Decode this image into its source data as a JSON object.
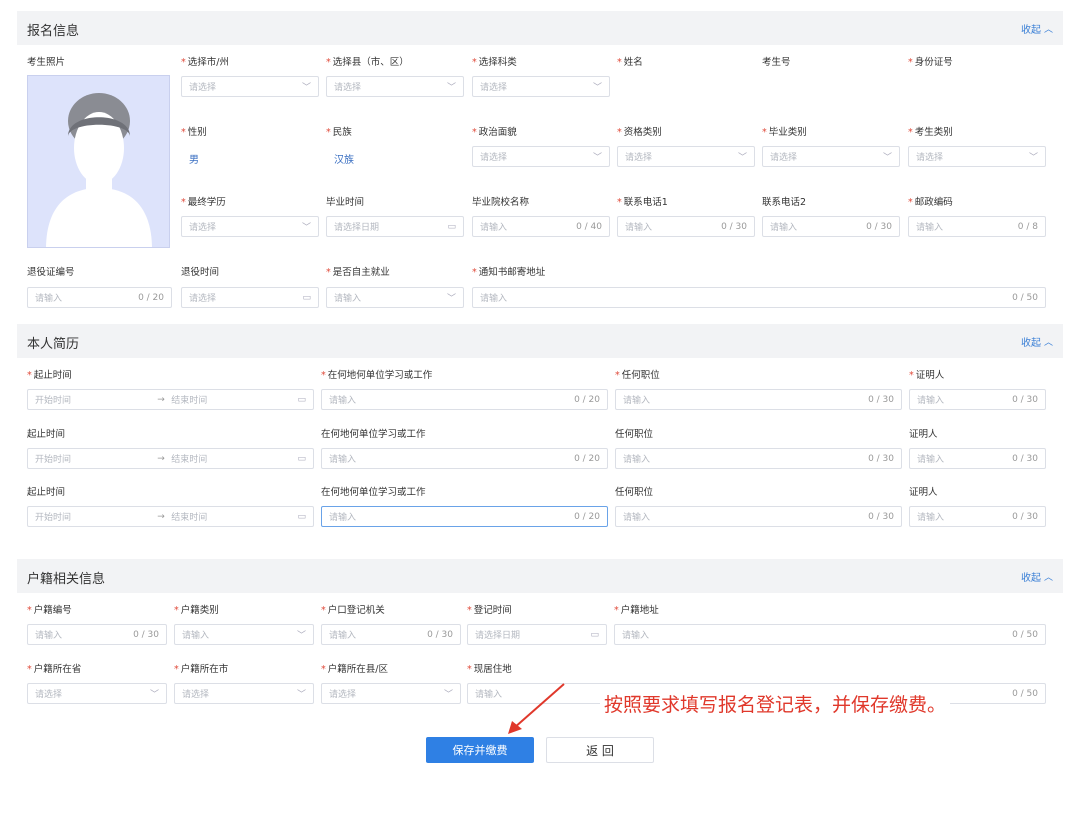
{
  "sections": {
    "registration": {
      "title": "报名信息",
      "collapse": "收起"
    },
    "resume": {
      "title": "本人简历",
      "collapse": "收起"
    },
    "household": {
      "title": "户籍相关信息",
      "collapse": "收起"
    }
  },
  "placeholders": {
    "select": "请选择",
    "input": "请输入",
    "date": "请选择日期",
    "start": "开始时间",
    "end": "结束时间",
    "arrow": "→"
  },
  "reg": {
    "photo_label": "考生照片",
    "city": "选择市/州",
    "county": "选择县（市、区）",
    "subject": "选择科类",
    "name": "姓名",
    "exam_no": "考生号",
    "id_no": "身份证号",
    "gender": "性别",
    "gender_value": "男",
    "ethnicity": "民族",
    "ethnicity_value": "汉族",
    "political": "政治面貌",
    "qualification": "资格类别",
    "grad_type": "毕业类别",
    "candidate_type": "考生类别",
    "education": "最终学历",
    "grad_time": "毕业时间",
    "school": "毕业院校名称",
    "school_count": "0 / 40",
    "phone1": "联系电话1",
    "phone1_count": "0 / 30",
    "phone2": "联系电话2",
    "phone2_count": "0 / 30",
    "postcode": "邮政编码",
    "postcode_count": "0 / 8",
    "veteran_no": "退役证编号",
    "veteran_count": "0 / 20",
    "veteran_time": "退役时间",
    "self_employed": "是否自主就业",
    "address": "通知书邮寄地址",
    "address_count": "0 / 50"
  },
  "resume": {
    "period": "起止时间",
    "place": "在何地何单位学习或工作",
    "place_count": "0 / 20",
    "position": "任何职位",
    "position_count": "0 / 30",
    "witness": "证明人",
    "witness_count": "0 / 30"
  },
  "household": {
    "hukou_no": "户籍编号",
    "hukou_no_count": "0 / 30",
    "hukou_type": "户籍类别",
    "registry": "户口登记机关",
    "registry_count": "0 / 30",
    "reg_time": "登记时间",
    "hukou_addr": "户籍地址",
    "hukou_addr_count": "0 / 50",
    "province": "户籍所在省",
    "city": "户籍所在市",
    "county": "户籍所在县/区",
    "residence": "现居住地",
    "residence_count": "0 / 50"
  },
  "actions": {
    "save_pay": "保存并缴费",
    "back": "返 回"
  },
  "annotation": "按照要求填写报名登记表，并保存缴费。"
}
